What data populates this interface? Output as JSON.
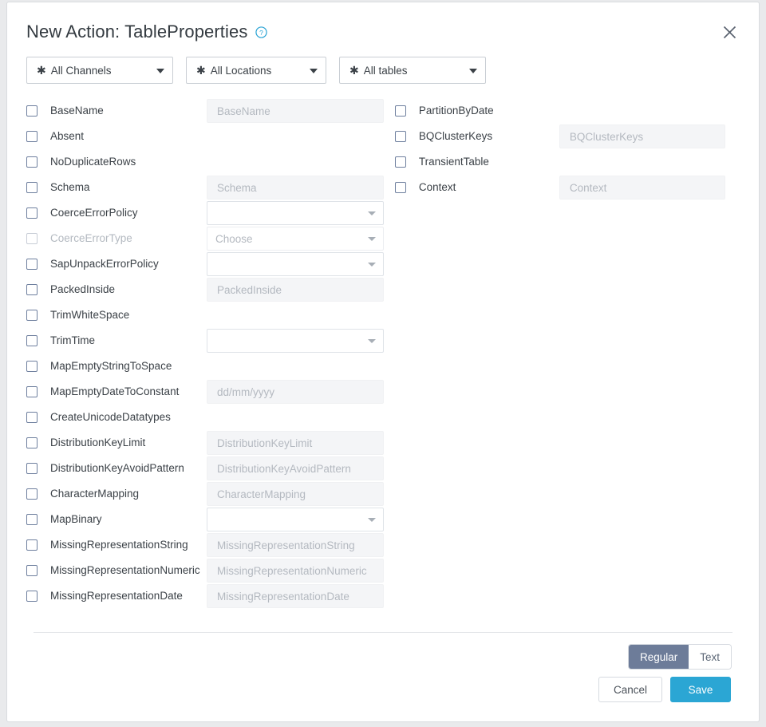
{
  "dialog": {
    "title": "New Action: TableProperties",
    "help_icon": "help-circle-icon",
    "close_icon": "close-icon"
  },
  "scope_selectors": [
    {
      "star": "✱",
      "label": "All Channels",
      "caret": "caret-down-icon"
    },
    {
      "star": "✱",
      "label": "All Locations",
      "caret": "caret-down-icon"
    },
    {
      "star": "✱",
      "label": "All tables",
      "caret": "caret-down-icon"
    }
  ],
  "left_column": [
    {
      "label": "BaseName",
      "control": "text",
      "placeholder": "BaseName",
      "checked": false,
      "disabled": false
    },
    {
      "label": "Absent",
      "control": "none",
      "placeholder": "",
      "checked": false,
      "disabled": false
    },
    {
      "label": "NoDuplicateRows",
      "control": "none",
      "placeholder": "",
      "checked": false,
      "disabled": false
    },
    {
      "label": "Schema",
      "control": "text",
      "placeholder": "Schema",
      "checked": false,
      "disabled": false
    },
    {
      "label": "CoerceErrorPolicy",
      "control": "select",
      "placeholder": "",
      "checked": false,
      "disabled": false
    },
    {
      "label": "CoerceErrorType",
      "control": "select",
      "placeholder": "Choose",
      "checked": false,
      "disabled": true
    },
    {
      "label": "SapUnpackErrorPolicy",
      "control": "select",
      "placeholder": "",
      "checked": false,
      "disabled": false
    },
    {
      "label": "PackedInside",
      "control": "text",
      "placeholder": "PackedInside",
      "checked": false,
      "disabled": false
    },
    {
      "label": "TrimWhiteSpace",
      "control": "none",
      "placeholder": "",
      "checked": false,
      "disabled": false
    },
    {
      "label": "TrimTime",
      "control": "select",
      "placeholder": "",
      "checked": false,
      "disabled": false
    },
    {
      "label": "MapEmptyStringToSpace",
      "control": "none",
      "placeholder": "",
      "checked": false,
      "disabled": false
    },
    {
      "label": "MapEmptyDateToConstant",
      "control": "text",
      "placeholder": "dd/mm/yyyy",
      "checked": false,
      "disabled": false
    },
    {
      "label": "CreateUnicodeDatatypes",
      "control": "none",
      "placeholder": "",
      "checked": false,
      "disabled": false
    },
    {
      "label": "DistributionKeyLimit",
      "control": "text",
      "placeholder": "DistributionKeyLimit",
      "checked": false,
      "disabled": false
    },
    {
      "label": "DistributionKeyAvoidPattern",
      "control": "text",
      "placeholder": "DistributionKeyAvoidPattern",
      "checked": false,
      "disabled": false
    },
    {
      "label": "CharacterMapping",
      "control": "text",
      "placeholder": "CharacterMapping",
      "checked": false,
      "disabled": false
    },
    {
      "label": "MapBinary",
      "control": "select",
      "placeholder": "",
      "checked": false,
      "disabled": false
    },
    {
      "label": "MissingRepresentationString",
      "control": "text",
      "placeholder": "MissingRepresentationString",
      "checked": false,
      "disabled": false
    },
    {
      "label": "MissingRepresentationNumeric",
      "control": "text",
      "placeholder": "MissingRepresentationNumeric",
      "checked": false,
      "disabled": false
    },
    {
      "label": "MissingRepresentationDate",
      "control": "text",
      "placeholder": "MissingRepresentationDate",
      "checked": false,
      "disabled": false
    }
  ],
  "right_column": [
    {
      "label": "PartitionByDate",
      "control": "none",
      "placeholder": "",
      "checked": false,
      "disabled": false
    },
    {
      "label": "BQClusterKeys",
      "control": "text",
      "placeholder": "BQClusterKeys",
      "checked": false,
      "disabled": false
    },
    {
      "label": "TransientTable",
      "control": "none",
      "placeholder": "",
      "checked": false,
      "disabled": false
    },
    {
      "label": "Context",
      "control": "text",
      "placeholder": "Context",
      "checked": false,
      "disabled": false
    }
  ],
  "view_toggle": {
    "options": [
      "Regular",
      "Text"
    ],
    "selected": "Regular"
  },
  "footer": {
    "cancel_label": "Cancel",
    "save_label": "Save"
  },
  "colors": {
    "accent": "#2ba6d4",
    "toggle_active": "#6d7c99",
    "checkbox_border": "#6e7f9e",
    "help_icon": "#29a3d4",
    "text": "#3b4147",
    "placeholder": "#b4b9c0"
  }
}
